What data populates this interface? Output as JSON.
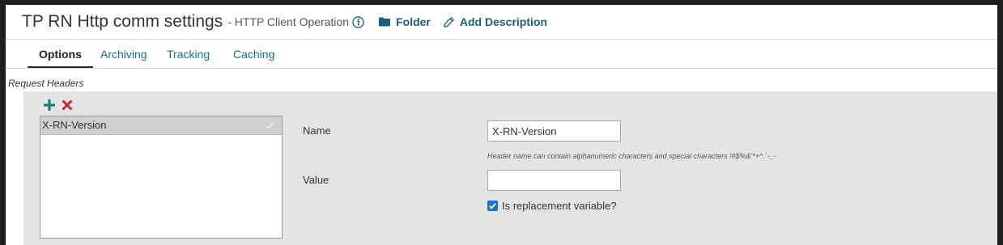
{
  "header": {
    "title": "TP RN Http comm settings",
    "subtitle": "- HTTP Client Operation",
    "info_icon": "info-circle-icon",
    "folder_label": "Folder",
    "folder_icon": "folder-icon",
    "description_label": "Add Description",
    "description_icon": "pencil-icon"
  },
  "tabs": [
    {
      "label": "Options",
      "active": true
    },
    {
      "label": "Archiving",
      "active": false
    },
    {
      "label": "Tracking",
      "active": false
    },
    {
      "label": "Caching",
      "active": false
    }
  ],
  "request_headers": {
    "title": "Request Headers",
    "add_icon": "plus-icon",
    "remove_icon": "x-icon",
    "items": [
      {
        "label": "X-RN-Version",
        "selected": true
      }
    ],
    "name_label": "Name",
    "name_value": "X-RN-Version",
    "name_hint": "Header name can contain alphanumeric characters and special characters !#$%&'*+^.`-_-",
    "value_label": "Value",
    "value_value": "",
    "replacement_label": "Is replacement variable?",
    "replacement_checked": true
  },
  "colors": {
    "link": "#1b5f7a",
    "add": "#1f7a7a",
    "remove": "#c8283a",
    "checkbox": "#1a73c8"
  }
}
